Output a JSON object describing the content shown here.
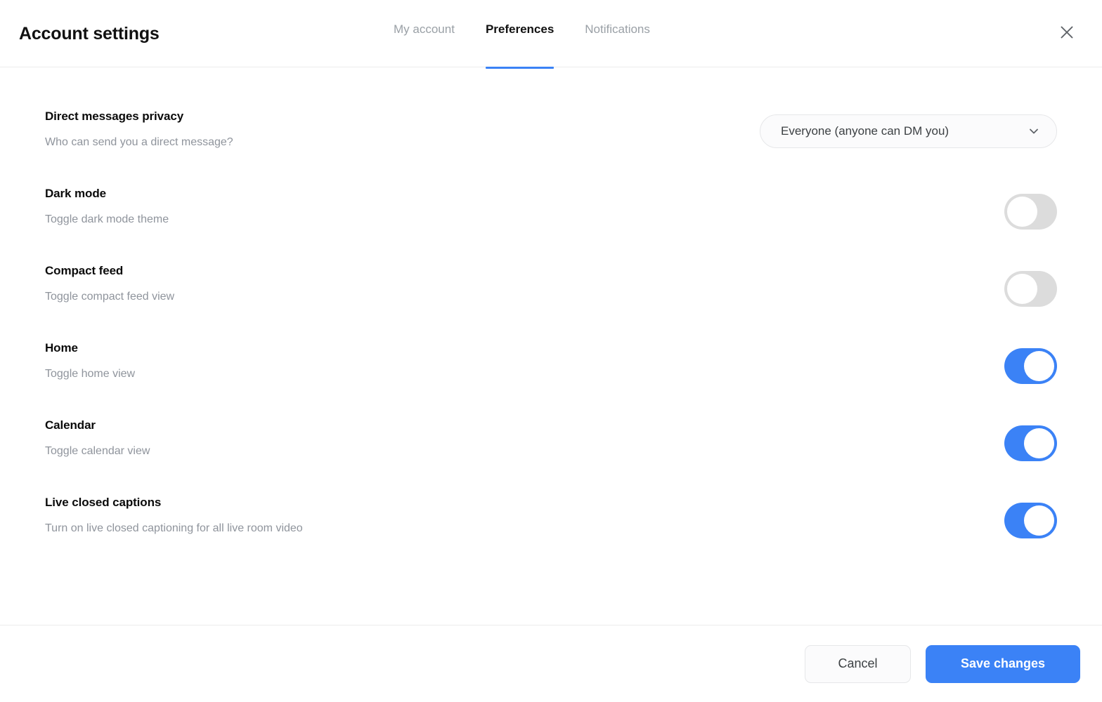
{
  "header": {
    "title": "Account settings",
    "tabs": [
      {
        "label": "My account",
        "active": false
      },
      {
        "label": "Preferences",
        "active": true
      },
      {
        "label": "Notifications",
        "active": false
      }
    ],
    "close_icon": "close-icon",
    "active_tab_underline_color": "#3b82f6"
  },
  "settings": [
    {
      "title": "Direct messages privacy",
      "description": "Who can send you a direct message?",
      "control": "dropdown",
      "value": "Everyone (anyone can DM you)",
      "chevron_icon": "chevron-down-icon"
    },
    {
      "title": "Dark mode",
      "description": "Toggle dark mode theme",
      "control": "toggle",
      "value": "off"
    },
    {
      "title": "Compact feed",
      "description": "Toggle compact feed view",
      "control": "toggle",
      "value": "off"
    },
    {
      "title": "Home",
      "description": "Toggle home view",
      "control": "toggle",
      "value": "on"
    },
    {
      "title": "Calendar",
      "description": "Toggle calendar view",
      "control": "toggle",
      "value": "on"
    },
    {
      "title": "Live closed captions",
      "description": "Turn on live closed captioning for all live room video",
      "control": "toggle",
      "value": "on"
    }
  ],
  "footer": {
    "cancel_label": "Cancel",
    "save_label": "Save changes",
    "save_color": "#3b82f6"
  },
  "colors": {
    "accent": "#3b82f6",
    "toggle_off": "#dcdcdc",
    "muted_text": "#8f949c",
    "divider": "#ececec"
  }
}
